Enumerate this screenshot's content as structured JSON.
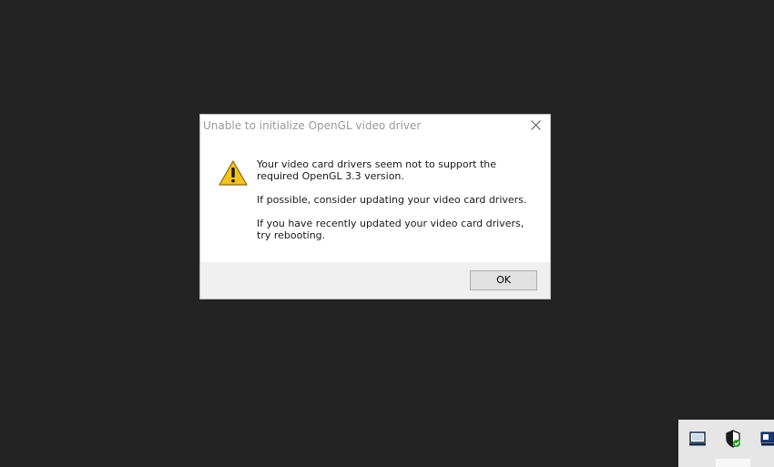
{
  "dialog": {
    "title": "Unable to initialize OpenGL video driver",
    "icon": "warning-icon",
    "message": {
      "line1": "Your video card drivers seem not to support the required OpenGL 3.3 version.",
      "line2": "If possible, consider updating your video card drivers.",
      "line3": "If you have recently updated your video card drivers, try rebooting."
    },
    "ok_label": "OK",
    "close_icon": "close-icon"
  },
  "tray": {
    "icons": [
      "monitor-icon",
      "security-shield-icon",
      "network-icon"
    ]
  },
  "colors": {
    "desktop": "#232323",
    "dialog_bg": "#ffffff",
    "footer_bg": "#f0f0f0",
    "button_bg": "#e1e1e1",
    "tray_bg": "#e6e6e6",
    "warning_yellow": "#f4c320"
  }
}
